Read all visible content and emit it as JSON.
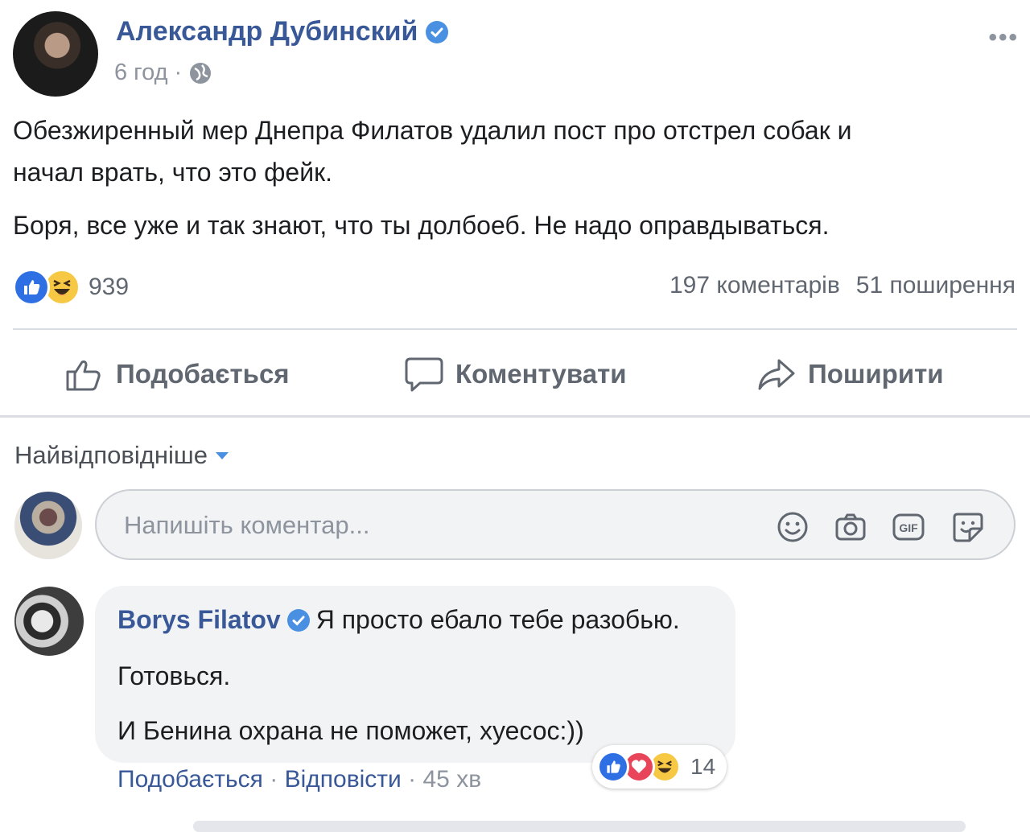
{
  "post": {
    "author": "Александр Дубинский",
    "time": "6 год",
    "separator": "·",
    "more_label": "•••",
    "paragraphs": [
      "Обезжиренный мер Днепра Филатов удалил пост про отстрел собак и",
      "начал врать, что это фейк.",
      "Боря, все уже и так знают, что ты долбоеб. Не надо оправдываться."
    ],
    "reactions_count": "939",
    "comments_count": "197 коментарів",
    "shares_count": "51 поширення"
  },
  "actions": {
    "like_label": "Подобається",
    "comment_label": "Коментувати",
    "share_label": "Поширити"
  },
  "comments_section": {
    "sort_label": "Найвідповідніше",
    "composer_placeholder": "Напишіть коментар...",
    "composer_icons": [
      "emoji-icon",
      "camera-icon",
      "gif-icon",
      "sticker-icon"
    ],
    "gif_label": "GIF"
  },
  "comment": {
    "author": "Borys Filatov",
    "text_line1": "Я просто ебало тебе разобью.",
    "text_line2": "Готовься.",
    "text_line3": "И Бенина охрана не поможет, хуесос:))",
    "reaction_count": "14",
    "like_label": "Подобається",
    "reply_label": "Відповісти",
    "time": "45 хв",
    "dot": "·"
  },
  "colors": {
    "link_blue": "#385898",
    "muted": "#8d949e",
    "like_blue": "#2f6fe4",
    "haha_yellow": "#f7c844",
    "love_red": "#e8445a"
  }
}
